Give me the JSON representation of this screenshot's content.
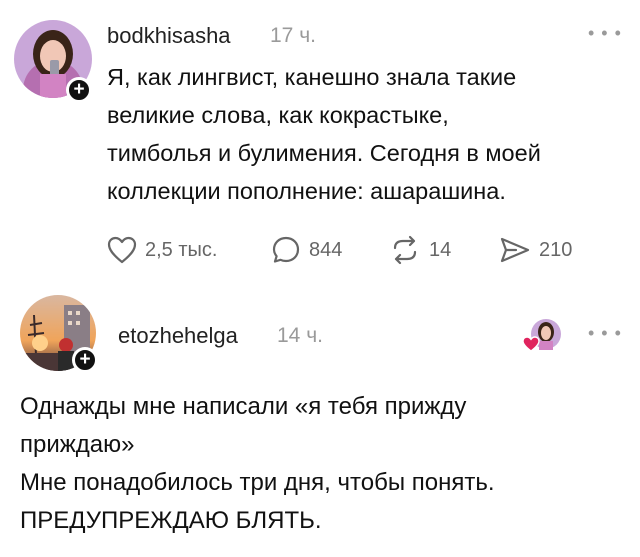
{
  "post1": {
    "username": "bodkhisasha",
    "time": "17 ч.",
    "text_lines": [
      "Я, как лингвист, канешно знала такие",
      "великие слова, как кокрастыке,",
      "тимболья и булимения. Сегодня в моей",
      "коллекции пополнение: ашарашина."
    ],
    "likes": "2,5 тыс.",
    "comments": "844",
    "reposts": "14",
    "shares": "210",
    "more_icon": "more-dots-icon"
  },
  "post2": {
    "username": "etozhehelga",
    "time": "14 ч.",
    "text_lines": [
      "Однажды мне написали «я тебя прижду",
      "прижда‌ю»",
      "Мне понадобилось три дня, чтобы понять.",
      "ПРЕДУПРЕЖДАЮ БЛЯТЬ."
    ],
    "more_icon": "more-dots-icon"
  },
  "icons": {
    "like": "heart-icon",
    "comment": "comment-bubble-icon",
    "repost": "repost-arrows-icon",
    "share": "send-icon",
    "follow": "plus-icon"
  },
  "colors": {
    "text": "#111111",
    "muted": "#9a9a9a",
    "action": "#666666",
    "heart": "#e0245e"
  }
}
